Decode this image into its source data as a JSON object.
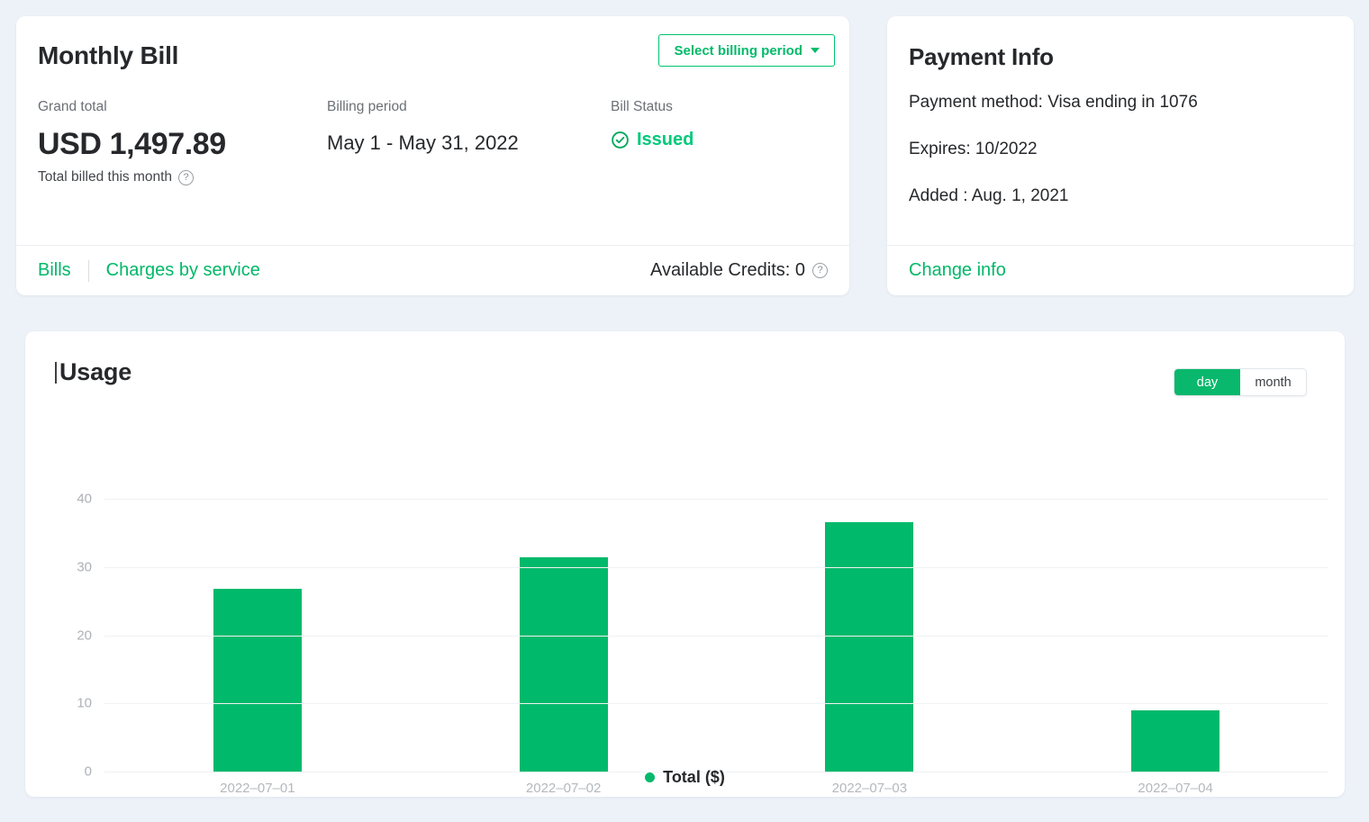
{
  "theme": {
    "page_background": "#edf2f9",
    "accent_green": "#00b868",
    "bar_green": "#00b96b",
    "status_green": "#00c97a",
    "text_dark": "#26282b",
    "muted": "#6c7076"
  },
  "bill_card": {
    "title": "Monthly Bill",
    "select_period_button": "Select billing period",
    "stats": {
      "grand_total_label": "Grand total",
      "grand_total_value": "USD 1,497.89",
      "grand_total_sub": "Total billed this month",
      "billing_period_label": "Billing period",
      "billing_period_value": "May 1 - May 31, 2022",
      "bill_status_label": "Bill Status",
      "bill_status_value": "Issued"
    },
    "footer": {
      "bills_link": "Bills",
      "charges_link": "Charges by service",
      "available_credits": "Available Credits: 0"
    }
  },
  "payment_card": {
    "title": "Payment Info",
    "payment_method": "Payment method: Visa ending in 1076",
    "expires": "Expires: 10/2022",
    "added": "Added : Aug. 1, 2021",
    "change_info_link": "Change info"
  },
  "usage_card": {
    "title": "Usage",
    "toggle": {
      "options": [
        "day",
        "month"
      ],
      "selected": "day"
    }
  },
  "chart_data": {
    "type": "bar",
    "title": "Usage",
    "categories": [
      "2022–07–01",
      "2022–07–02",
      "2022–07–03",
      "2022–07–04"
    ],
    "series": [
      {
        "name": "Total ($)",
        "color": "#00b96b",
        "values": [
          26.9,
          31.5,
          36.7,
          9.1
        ]
      }
    ],
    "legend": [
      "Total ($)"
    ],
    "legend_position": "bottom-center",
    "xlabel": "",
    "ylabel": "",
    "ylim": [
      0,
      40
    ],
    "yticks": [
      0,
      10,
      20,
      30,
      40
    ],
    "grid": true
  }
}
